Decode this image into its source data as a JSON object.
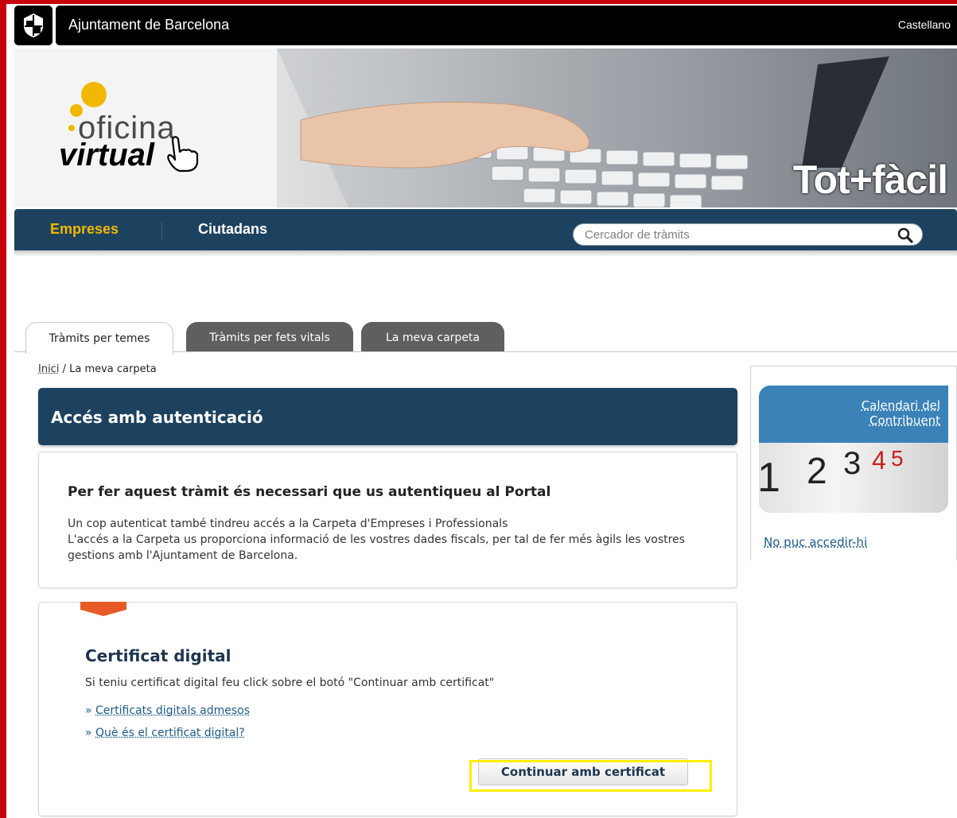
{
  "header": {
    "site_title": "Ajuntament de Barcelona",
    "language_link": "Castellano"
  },
  "banner": {
    "logo_word1": "oficina",
    "logo_word2": "virtual",
    "slogan": "Tot+fàcil"
  },
  "nav": {
    "items": [
      {
        "label": "Empreses",
        "active": true
      },
      {
        "label": "Ciutadans",
        "active": false
      }
    ],
    "search_placeholder": "Cercador de tràmits"
  },
  "tabs": [
    {
      "label": "Tràmits per temes",
      "active": true
    },
    {
      "label": "Tràmits per fets vitals",
      "active": false
    },
    {
      "label": "La meva carpeta",
      "active": false
    }
  ],
  "breadcrumb": {
    "home": "Inici",
    "separator": " / ",
    "current": "La meva carpeta"
  },
  "main": {
    "title": "Accés amb autenticació",
    "info": {
      "heading": "Per fer aquest tràmit és necessari que us autentiqueu al Portal",
      "line1": "Un cop autenticat també tindreu accés a la Carpeta d'Empreses i Professionals",
      "line2": "L'accés a la Carpeta us proporciona informació de les vostres dades fiscals, per tal de fer més àgils les vostres gestions amb l'Ajuntament de Barcelona."
    },
    "certificate": {
      "title": "Certificat digital",
      "description": "Si teniu certificat digital feu click sobre el botó \"Continuar amb certificat\"",
      "link_prefix": "» ",
      "links": [
        "Certificats digitals admesos",
        "Què és el certificat digital?"
      ],
      "button_label": "Continuar amb certificat"
    }
  },
  "sidebar": {
    "calendar_title": "Calendari del Contribuent",
    "calendar_numbers": [
      "1",
      "2",
      "3",
      "4",
      "5"
    ],
    "help_link": "No puc accedir-hi"
  },
  "colors": {
    "brand_dark_blue": "#1d4260",
    "accent_yellow": "#f2b800",
    "outer_red": "#c8000a",
    "link_blue": "#1d5b8c",
    "highlight": "#ffee00"
  }
}
